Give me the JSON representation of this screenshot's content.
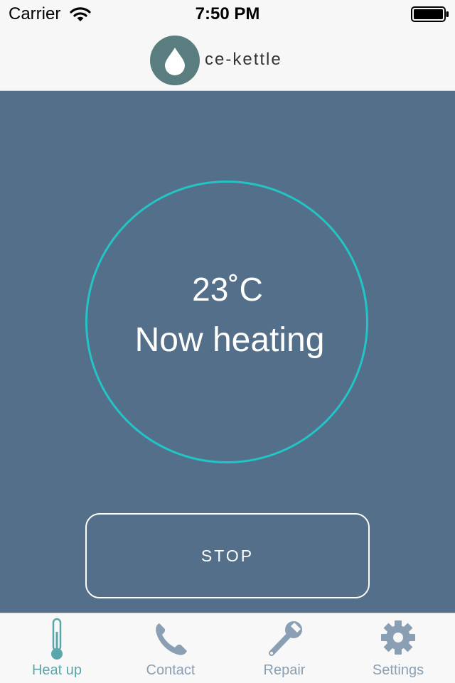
{
  "status_bar": {
    "carrier": "Carrier",
    "time": "7:50 PM"
  },
  "header": {
    "brand": "ce-kettle",
    "logo_icon": "water-drop-icon"
  },
  "main": {
    "temperature": "23˚C",
    "status": "Now heating",
    "stop_label": "STOP"
  },
  "tabs": [
    {
      "label": "Heat up",
      "icon": "thermometer-icon",
      "active": true
    },
    {
      "label": "Contact",
      "icon": "phone-icon",
      "active": false
    },
    {
      "label": "Repair",
      "icon": "wrench-icon",
      "active": false
    },
    {
      "label": "Settings",
      "icon": "gear-icon",
      "active": false
    }
  ],
  "colors": {
    "main_background": "#546f89",
    "ring": "#22c4c6",
    "tab_active": "#5ba6ab",
    "tab_inactive": "#8a9fb3",
    "logo": "#5a7d7f"
  }
}
